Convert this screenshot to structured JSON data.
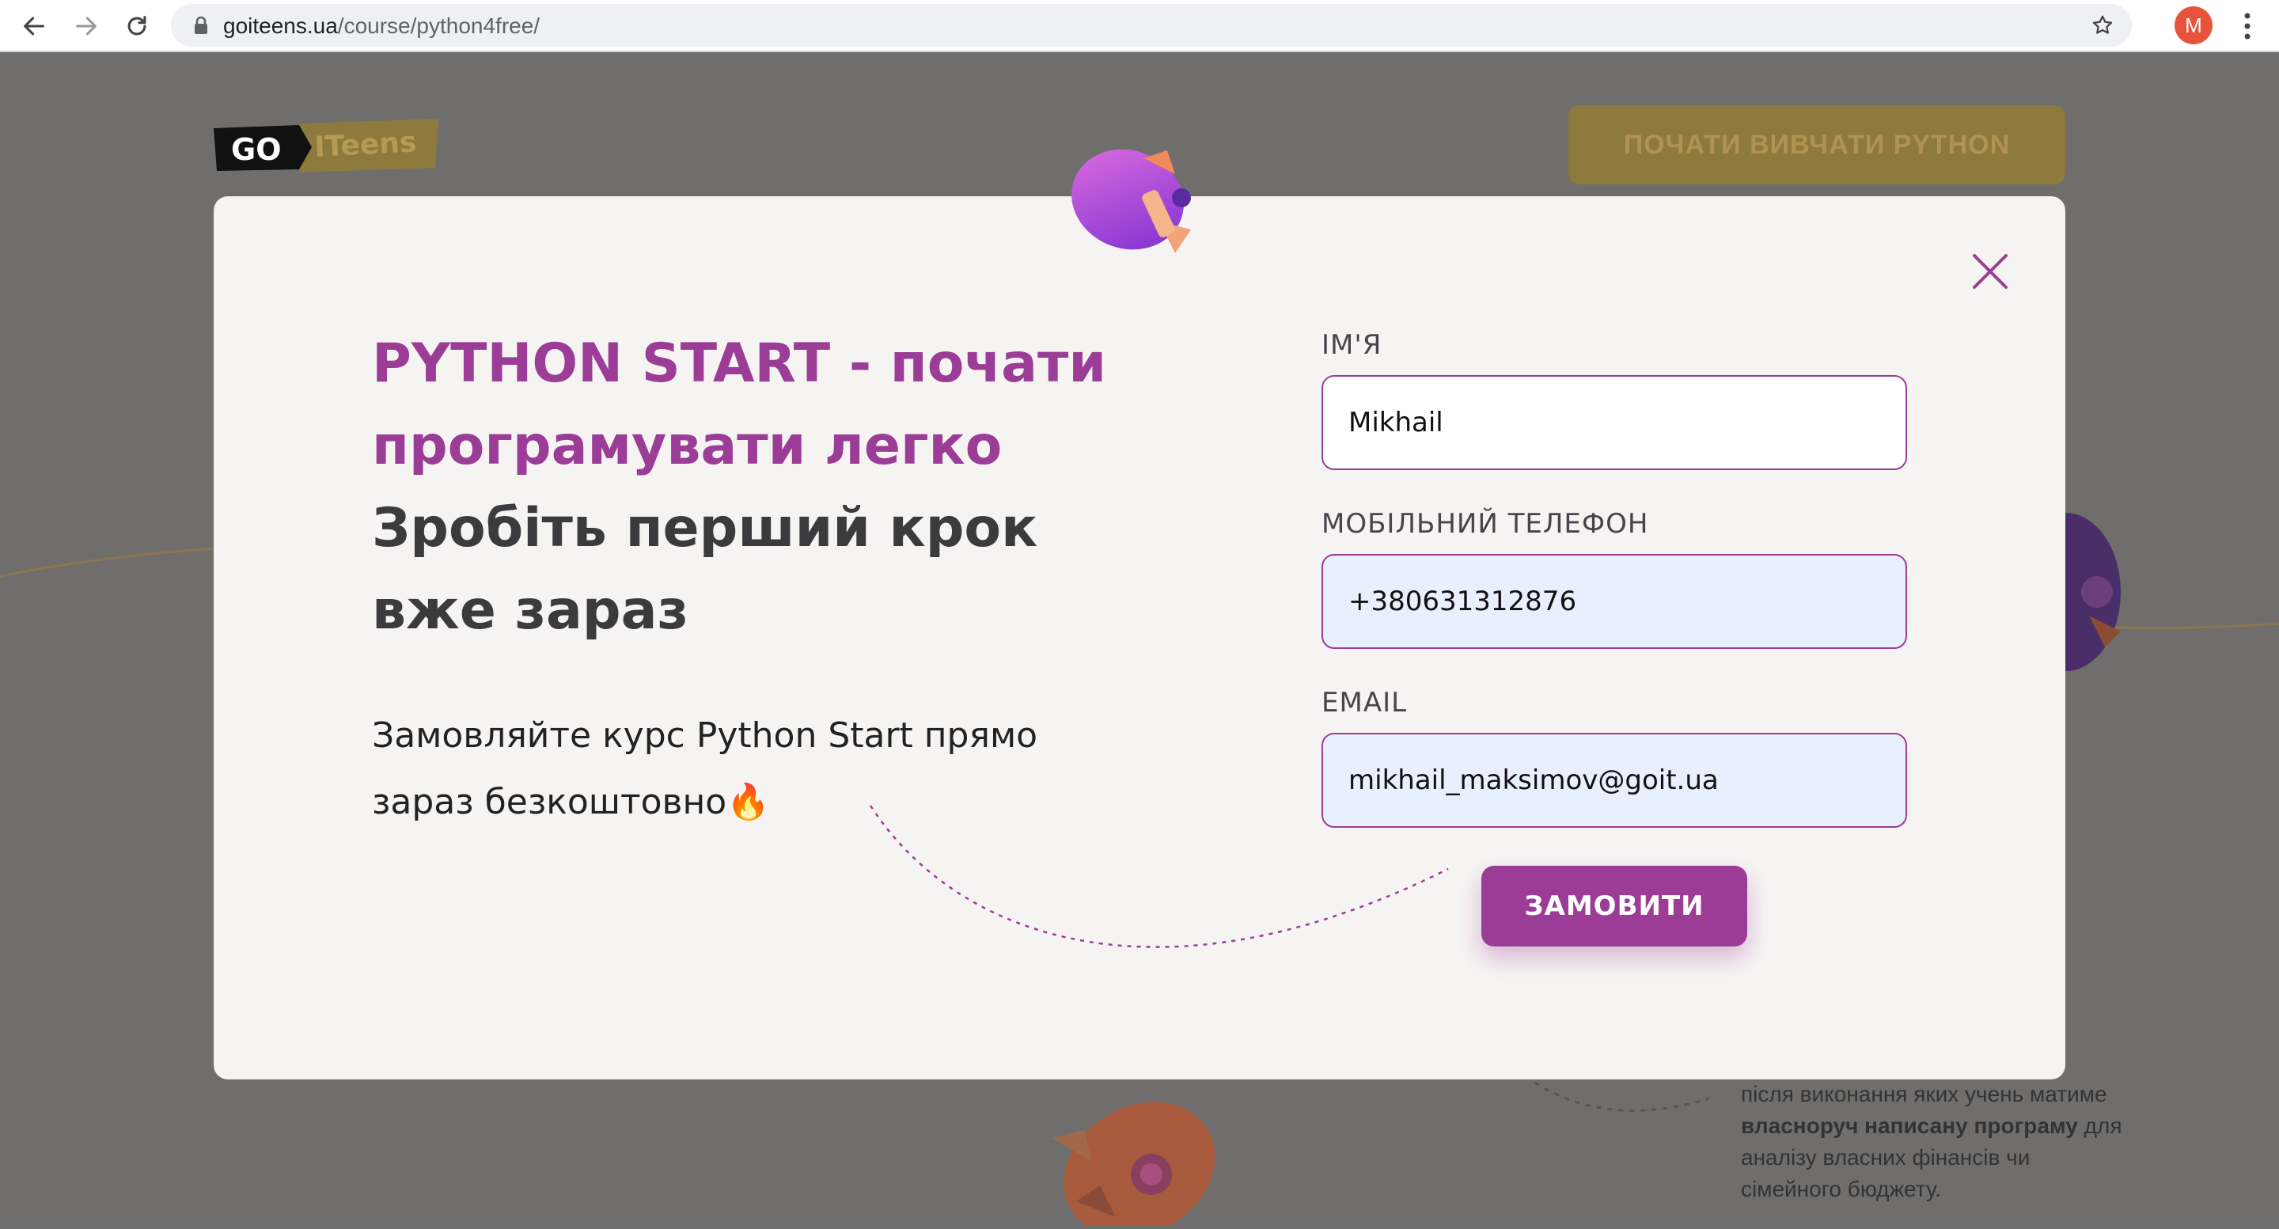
{
  "browser": {
    "url_host": "goiteens.ua",
    "url_path": "/course/python4free/",
    "profile_initial": "M"
  },
  "background_page": {
    "logo": {
      "go": "GO",
      "iteens": "ITeens"
    },
    "cta_label": "ПОЧАТИ ВИВЧАТИ PYTHON",
    "description": {
      "line1": "після виконання яких учень матиме",
      "bold": "власноруч написану програму",
      "after_bold": " для",
      "line3": "аналізу власних фінансів чи",
      "line4": "сімейного бюджету."
    }
  },
  "modal": {
    "headline_accent_line1": "PYTHON START - почати",
    "headline_accent_line2": "програмувати легко",
    "headline_dark_line1": "Зробіть перший крок",
    "headline_dark_line2": "вже зараз",
    "subtitle_line1": "Замовляйте курс Python Start прямо",
    "subtitle_line2": "зараз безкоштовно🔥",
    "form": {
      "name_label": "ІМ'Я",
      "name_value": "Mikhail",
      "phone_label": "МОБІЛЬНИЙ ТЕЛЕФОН",
      "phone_value": "+380631312876",
      "email_label": "EMAIL",
      "email_value": "mikhail_maksimov@goit.ua",
      "submit_label": "ЗАМОВИТИ"
    }
  },
  "colors": {
    "accent": "#9b3d97",
    "heading_dark": "#3b3a3d",
    "input_filled_bg": "#e8effd",
    "cta_yellow": "#f2b632"
  },
  "icons": [
    "back-arrow-icon",
    "forward-arrow-icon",
    "reload-icon",
    "lock-icon",
    "star-icon",
    "menu-dots-icon",
    "close-icon",
    "rocket-icon"
  ]
}
